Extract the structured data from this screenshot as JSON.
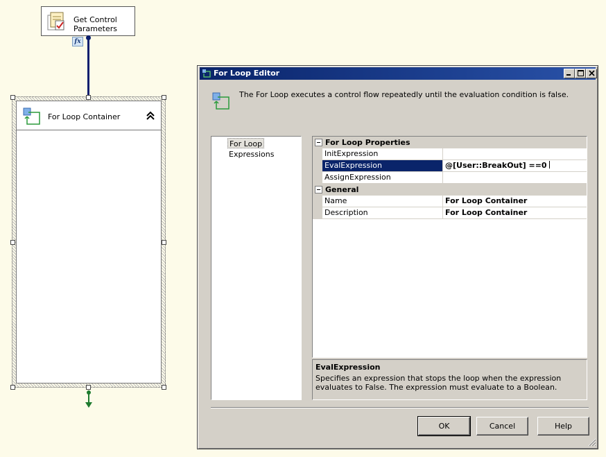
{
  "canvas": {
    "task": {
      "label_line1": "Get Control",
      "label_line2": "Parameters",
      "fx_badge": "fx"
    },
    "container": {
      "title": "For Loop Container"
    }
  },
  "dialog": {
    "title": "For Loop Editor",
    "header_text": "The For Loop executes a control flow repeatedly until the evaluation condition is false.",
    "nav": {
      "items": [
        "For Loop",
        "Expressions"
      ],
      "selected": "For Loop"
    },
    "grid": {
      "categories": [
        {
          "label": "For Loop Properties",
          "properties": [
            {
              "name": "InitExpression",
              "value": ""
            },
            {
              "name": "EvalExpression",
              "value": "@[User::BreakOut] ==0"
            },
            {
              "name": "AssignExpression",
              "value": ""
            }
          ]
        },
        {
          "label": "General",
          "properties": [
            {
              "name": "Name",
              "value": "For Loop Container"
            },
            {
              "name": "Description",
              "value": "For Loop Container"
            }
          ]
        }
      ],
      "selected_property": "EvalExpression"
    },
    "description": {
      "title": "EvalExpression",
      "text": "Specifies an expression that stops the loop when the expression evaluates to False. The expression must evaluate to a Boolean."
    },
    "buttons": {
      "ok": "OK",
      "cancel": "Cancel",
      "help": "Help"
    }
  },
  "colors": {
    "selection": "#0a246a",
    "dialog_bg": "#d4d0c8",
    "canvas_bg": "#fdfbe9",
    "connector": "#0b1e6e",
    "success_arrow": "#1e7b2e"
  }
}
